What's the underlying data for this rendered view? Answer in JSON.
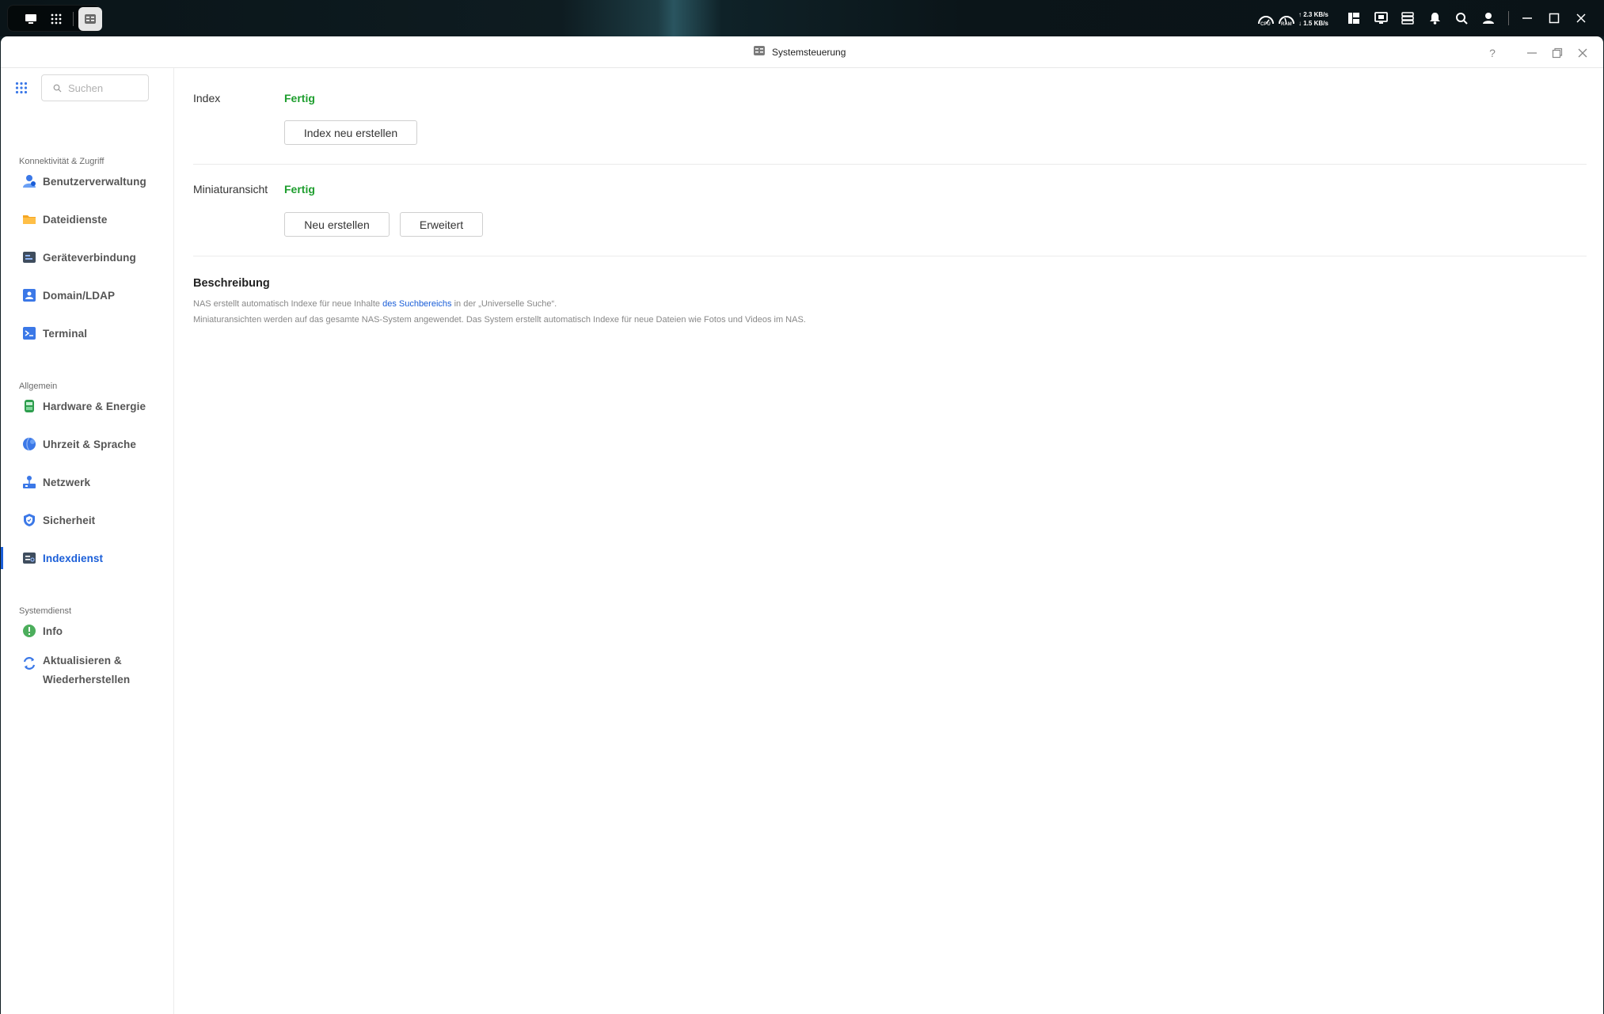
{
  "taskbar": {
    "left_icons": [
      "show-desktop-icon",
      "app-grid-icon"
    ],
    "open_app_icon": "control-panel-icon",
    "gauges": {
      "cpu_label": "CPU",
      "ram_label": "RAM"
    },
    "net": {
      "up": "2.3 KB/s",
      "down": "1.5 KB/s"
    },
    "right_icons": [
      "panel-layout-icon",
      "monitor-icon",
      "storage-icon",
      "bell-icon",
      "search-icon",
      "user-icon"
    ]
  },
  "window": {
    "title": "Systemsteuerung",
    "controls": {
      "help": "?"
    }
  },
  "sidebar": {
    "search_placeholder": "Suchen",
    "sections": [
      {
        "label": "Konnektivität & Zugriff",
        "items": [
          {
            "label": "Benutzerverwaltung",
            "icon": "users-icon"
          },
          {
            "label": "Dateidienste",
            "icon": "folder-icon"
          },
          {
            "label": "Geräteverbindung",
            "icon": "device-icon"
          },
          {
            "label": "Domain/LDAP",
            "icon": "domain-icon"
          },
          {
            "label": "Terminal",
            "icon": "terminal-icon"
          }
        ]
      },
      {
        "label": "Allgemein",
        "items": [
          {
            "label": "Hardware & Energie",
            "icon": "hardware-icon"
          },
          {
            "label": "Uhrzeit & Sprache",
            "icon": "globe-icon"
          },
          {
            "label": "Netzwerk",
            "icon": "network-icon"
          },
          {
            "label": "Sicherheit",
            "icon": "shield-icon"
          },
          {
            "label": "Indexdienst",
            "icon": "index-icon",
            "active": true
          }
        ]
      },
      {
        "label": "Systemdienst",
        "items": [
          {
            "label": "Info",
            "icon": "info-icon"
          },
          {
            "label": "Aktualisieren & Wiederherstellen",
            "icon": "update-icon"
          }
        ]
      }
    ]
  },
  "main": {
    "index": {
      "label": "Index",
      "status": "Fertig",
      "button": "Index neu erstellen"
    },
    "thumbnail": {
      "label": "Miniaturansicht",
      "status": "Fertig",
      "button_rebuild": "Neu erstellen",
      "button_advanced": "Erweitert"
    },
    "description": {
      "title": "Beschreibung",
      "line1_pre": "NAS erstellt automatisch Indexe für neue Inhalte ",
      "line1_link": "des Suchbereichs",
      "line1_post": " in der „Universelle Suche“.",
      "line2": "Miniaturansichten werden auf das gesamte NAS-System angewendet. Das System erstellt automatisch Indexe für neue Dateien wie Fotos und Videos im NAS."
    }
  },
  "colors": {
    "accent": "#1a5ed8",
    "success": "#1e9e2e"
  }
}
